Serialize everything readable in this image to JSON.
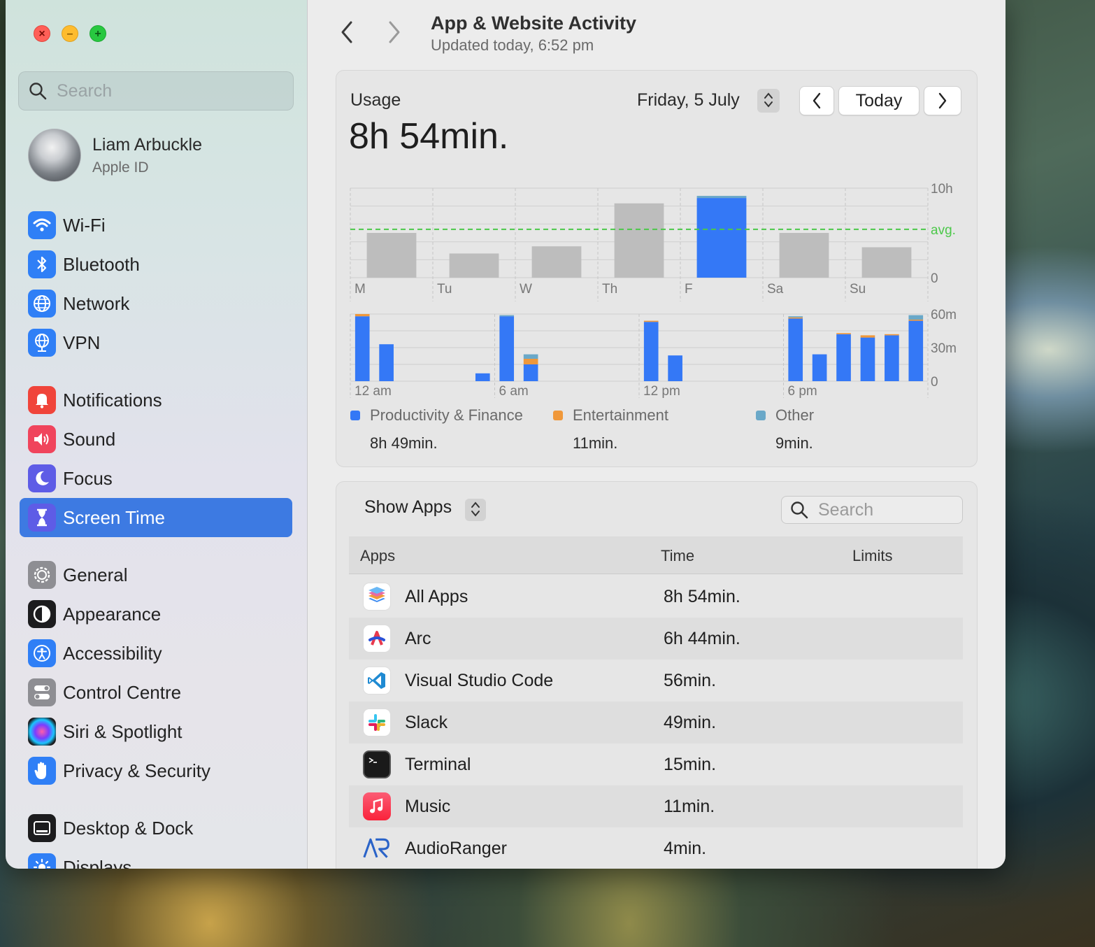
{
  "sidebar": {
    "search_placeholder": "Search",
    "profile": {
      "name": "Liam Arbuckle",
      "subtitle": "Apple ID"
    },
    "items": [
      {
        "label": "Wi-Fi",
        "icon": "wifi-icon",
        "color": "#2f7ff6"
      },
      {
        "label": "Bluetooth",
        "icon": "bluetooth-icon",
        "color": "#2f7ff6"
      },
      {
        "label": "Network",
        "icon": "globe-icon",
        "color": "#2f7ff6"
      },
      {
        "label": "VPN",
        "icon": "vpn-globe-icon",
        "color": "#2f7ff6"
      },
      {
        "label": "Notifications",
        "icon": "bell-icon",
        "color": "#f0443a"
      },
      {
        "label": "Sound",
        "icon": "speaker-icon",
        "color": "#f0445c"
      },
      {
        "label": "Focus",
        "icon": "moon-icon",
        "color": "#5e5ce6"
      },
      {
        "label": "Screen Time",
        "icon": "hourglass-icon",
        "color": "#5e5ce6",
        "active": true
      },
      {
        "label": "General",
        "icon": "gear-icon",
        "color": "#8e8e93"
      },
      {
        "label": "Appearance",
        "icon": "appearance-icon",
        "color": "#1c1c1e"
      },
      {
        "label": "Accessibility",
        "icon": "accessibility-icon",
        "color": "#2f7ff6"
      },
      {
        "label": "Control Centre",
        "icon": "toggles-icon",
        "color": "#8e8e93"
      },
      {
        "label": "Siri & Spotlight",
        "icon": "siri-icon",
        "color": "#6b2fb0"
      },
      {
        "label": "Privacy & Security",
        "icon": "hand-icon",
        "color": "#2f7ff6"
      },
      {
        "label": "Desktop & Dock",
        "icon": "dock-icon",
        "color": "#1c1c1e"
      },
      {
        "label": "Displays",
        "icon": "sun-icon",
        "color": "#2f7ff6"
      }
    ]
  },
  "header": {
    "title": "App & Website Activity",
    "subtitle": "Updated today, 6:52 pm"
  },
  "usage": {
    "label": "Usage",
    "total": "8h 54min.",
    "date": "Friday, 5 July",
    "today_button": "Today"
  },
  "chart_data": [
    {
      "type": "bar",
      "categories": [
        "M",
        "Tu",
        "W",
        "Th",
        "F",
        "Sa",
        "Su"
      ],
      "values": [
        5.0,
        2.7,
        3.5,
        8.3,
        8.9,
        5.0,
        3.4
      ],
      "highlight": "F",
      "highlight_color": "#3478f6",
      "color": "#bdbdbd",
      "average": 5.4,
      "average_label": "avg.",
      "average_color": "#4cc84a",
      "ylim": [
        0,
        10
      ],
      "ytick_labels": [
        "10h",
        "0"
      ]
    },
    {
      "type": "bar",
      "stacked": true,
      "hours": [
        0,
        1,
        5,
        6,
        7,
        12,
        13,
        18,
        19,
        20,
        21,
        22,
        23
      ],
      "series": [
        {
          "name": "Productivity & Finance",
          "color": "#3478f6",
          "values": [
            58,
            33,
            7,
            58,
            15,
            53,
            23,
            56,
            24,
            42,
            39,
            41,
            54
          ]
        },
        {
          "name": "Entertainment",
          "color": "#f0983a",
          "values": [
            2,
            0,
            0,
            0,
            5,
            1,
            0,
            1,
            0,
            1,
            2,
            1,
            1
          ]
        },
        {
          "name": "Other",
          "color": "#6aa8c8",
          "values": [
            0,
            0,
            0,
            1,
            4,
            0,
            0,
            1,
            0,
            0,
            0,
            0,
            4
          ]
        }
      ],
      "xtick_labels": [
        "12 am",
        "6 am",
        "12 pm",
        "6 pm"
      ],
      "ylim": [
        0,
        60
      ],
      "ytick_labels": [
        "60m",
        "30m",
        "0"
      ]
    }
  ],
  "legend": [
    {
      "name": "Productivity & Finance",
      "value": "8h 49min.",
      "color": "#3478f6"
    },
    {
      "name": "Entertainment",
      "value": "11min.",
      "color": "#f0983a"
    },
    {
      "name": "Other",
      "value": "9min.",
      "color": "#6aa8c8"
    }
  ],
  "apps_panel": {
    "show_label": "Show Apps",
    "search_placeholder": "Search",
    "columns": [
      "Apps",
      "Time",
      "Limits"
    ],
    "rows": [
      {
        "name": "All Apps",
        "time": "8h 54min.",
        "icon": "stack-icon"
      },
      {
        "name": "Arc",
        "time": "6h 44min.",
        "icon": "arc-icon"
      },
      {
        "name": "Visual Studio Code",
        "time": "56min.",
        "icon": "vscode-icon"
      },
      {
        "name": "Slack",
        "time": "49min.",
        "icon": "slack-icon"
      },
      {
        "name": "Terminal",
        "time": "15min.",
        "icon": "terminal-icon"
      },
      {
        "name": "Music",
        "time": "11min.",
        "icon": "music-icon"
      },
      {
        "name": "AudioRanger",
        "time": "4min.",
        "icon": "audioranger-icon"
      }
    ]
  }
}
